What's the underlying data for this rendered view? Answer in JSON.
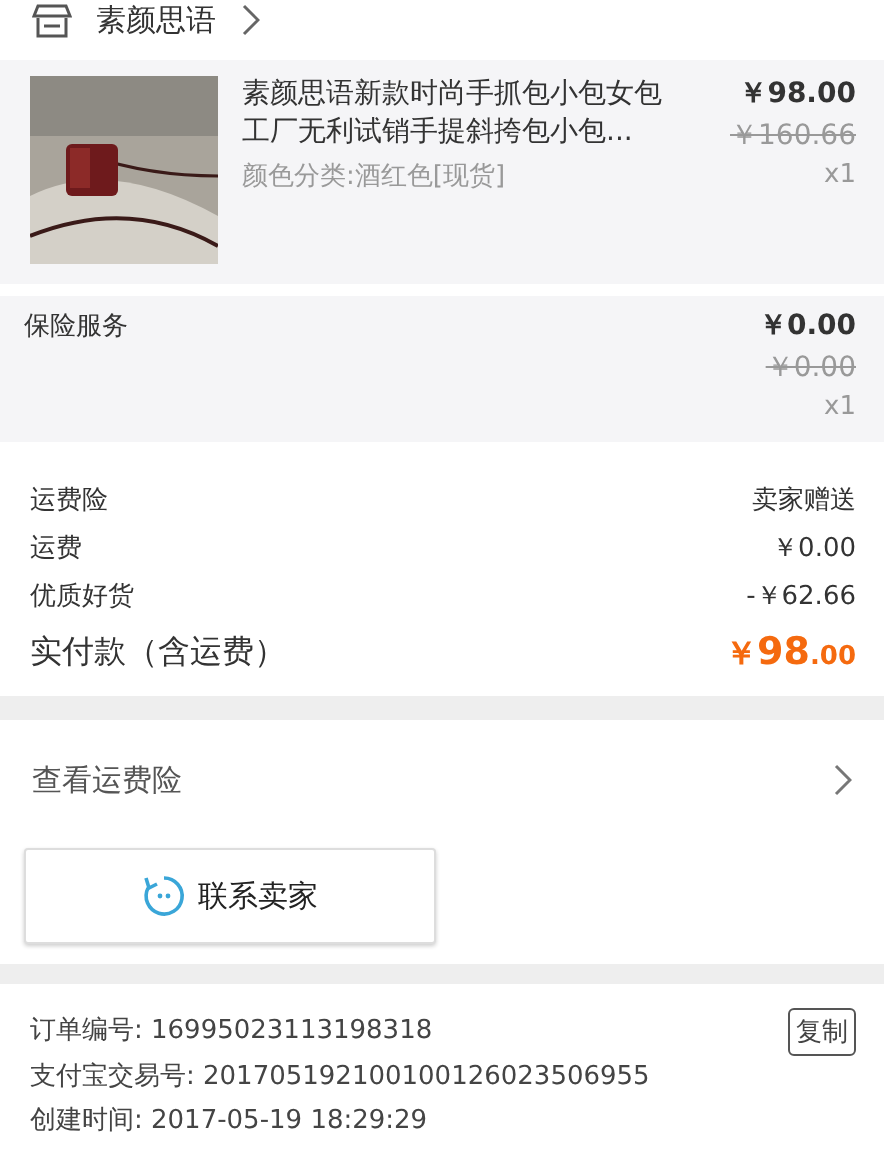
{
  "shop": {
    "name": "素颜思语"
  },
  "product": {
    "kind": "picture",
    "title": "素颜思语新款时尚手抓包小包女包工厂无利试销手提斜挎包小包...",
    "spec": "颜色分类:酒红色[现货]",
    "price": "￥98.00",
    "original_price": "￥160.66",
    "quantity": "x1"
  },
  "insurance": {
    "label": "保险服务",
    "price": "￥0.00",
    "original_price": "￥0.00",
    "quantity": "x1"
  },
  "fees": [
    {
      "label": "运费险",
      "value": "卖家赠送"
    },
    {
      "label": "运费",
      "value": "￥0.00"
    },
    {
      "label": "优质好货",
      "value": "-￥62.66"
    }
  ],
  "total": {
    "label": "实付款（含运费）",
    "currency": "￥",
    "integer": "98",
    "decimal": ".00"
  },
  "shipping_insurance_link": "查看运费险",
  "contact_button": "联系卖家",
  "order_info": [
    {
      "label": "订单编号:",
      "value": "16995023113198318"
    },
    {
      "label": "支付宝交易号:",
      "value": "201705192100100126023506955"
    },
    {
      "label": "创建时间:",
      "value": "2017-05-19 18:29:29"
    }
  ],
  "copy_button": "复制"
}
